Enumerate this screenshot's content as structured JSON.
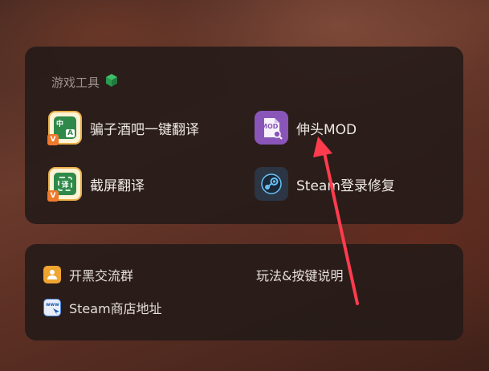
{
  "tools_panel": {
    "title": "游戏工具",
    "items": [
      {
        "label": "骗子酒吧一键翻译",
        "icon": "translate-icon",
        "badge": "V",
        "glyphs": [
          "中",
          "A"
        ]
      },
      {
        "label": "伸头MOD",
        "icon": "mod-file-icon",
        "glyph": "MOD"
      },
      {
        "label": "截屏翻译",
        "icon": "screenshot-translate-icon",
        "badge": "V",
        "glyph": "译"
      },
      {
        "label": "Steam登录修复",
        "icon": "steam-icon"
      }
    ]
  },
  "links_panel": {
    "items": [
      {
        "label": "开黑交流群",
        "icon": "group-icon"
      },
      {
        "label": "玩法&按键说明",
        "icon": ""
      },
      {
        "label": "Steam商店地址",
        "icon": "www-link-icon",
        "glyph": "www"
      }
    ]
  },
  "colors": {
    "accent_green": "#2f8a4a",
    "badge_orange": "#f07a2c",
    "mod_purple": "#8a55b8",
    "steam_dark": "#2b3544",
    "annotation_arrow": "#ff3b4e"
  }
}
